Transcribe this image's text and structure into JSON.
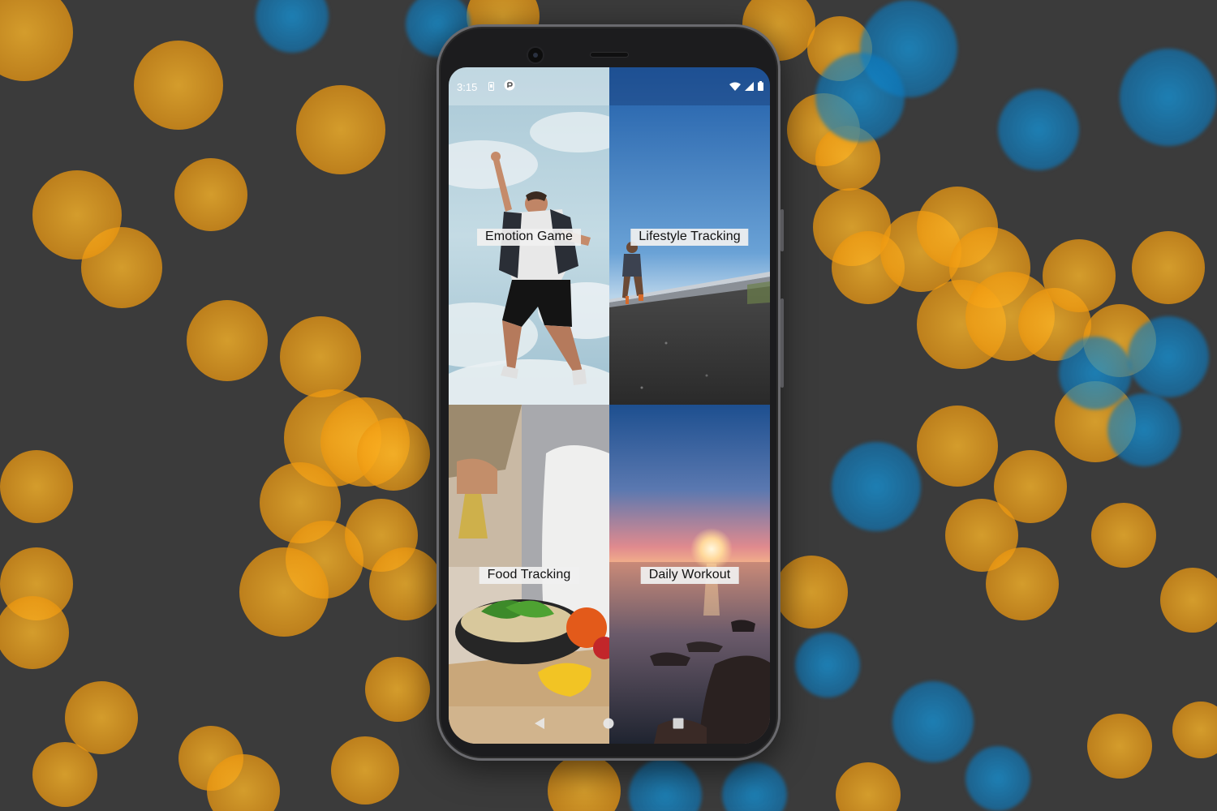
{
  "status_bar": {
    "time": "3:15",
    "left_icons": [
      "sim-card-icon",
      "notification-app-icon"
    ],
    "right_icons": [
      "wifi-icon",
      "cell-signal-icon",
      "battery-icon"
    ]
  },
  "tiles": [
    {
      "label": "Emotion Game",
      "image": "man-jumping-sky-photo"
    },
    {
      "label": "Lifestyle Tracking",
      "image": "runner-on-road-photo"
    },
    {
      "label": "Food Tracking",
      "image": "pouring-oil-salad-photo"
    },
    {
      "label": "Daily Workout",
      "image": "sunset-over-sea-photo"
    }
  ],
  "nav_bar": {
    "buttons": [
      "back-icon",
      "home-icon",
      "recents-icon"
    ]
  },
  "colors": {
    "background": "#3b3b3b",
    "bokeh_orange": "#f4a014",
    "bokeh_blue": "#1496dc",
    "phone_frame": "#1c1c1e",
    "label_bg": "#f0f0f0"
  }
}
